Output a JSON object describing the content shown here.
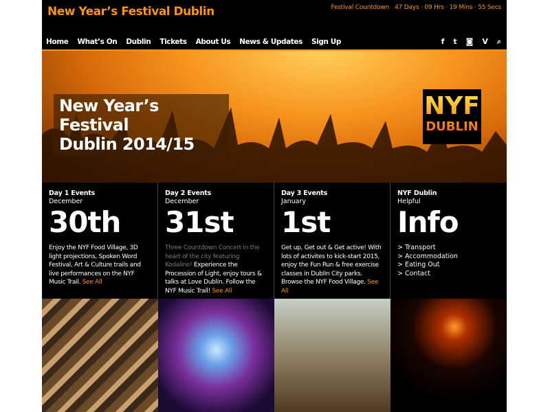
{
  "header": {
    "title": "New Year’s Festival Dublin",
    "countdown_label": "Festival Countdown",
    "countdown_value": "47 Days · 09 Hrs · 19 Mins · 55 Secs"
  },
  "nav": [
    "Home",
    "What’s On",
    "Dublin",
    "Tickets",
    "About Us",
    "News & Updates",
    "Sign Up"
  ],
  "social": {
    "facebook": "f",
    "twitter": "t",
    "instagram": "◙",
    "vine": "V",
    "search": "⌕"
  },
  "hero": {
    "title_line1": "New Year’s Festival",
    "title_line2": "Dublin 2014/15",
    "logo_top": "NYF",
    "logo_bottom": "DUBLIN"
  },
  "columns": [
    {
      "heading": "Day 1 Events",
      "sub": "December",
      "big": "30th",
      "text": "Enjoy the NYF Food Village, 3D light projections, Spoken Word Festival, Art & Culture trails and live performances on the NYF Music Trail. ",
      "link": "See All"
    },
    {
      "heading": "Day 2 Events",
      "sub": "December",
      "big": "31st",
      "grey": "Three Countdown Concert in the heart of the city featuring Kodaline!",
      "text": " Experience the Procession of Light, enjoy tours & talks at Love Dublin. Follow the NYF Music Trail! ",
      "link": "See All"
    },
    {
      "heading": "Day 3 Events",
      "sub": "January",
      "big": "1st",
      "text": "Get up, Get out & Get active! With lots of activites to kick-start 2015, enjoy the Fun Run & free exercise classes in Dublin City parks. Browse the NYF Food Village. ",
      "link": "See All"
    },
    {
      "heading": "NYF Dublin",
      "sub": "Helpful",
      "big": "Info",
      "links": [
        "> Transport",
        "> Accommodation",
        "> Eating Out",
        "> Contact"
      ]
    }
  ],
  "colors": {
    "accent": "#f7941d"
  }
}
